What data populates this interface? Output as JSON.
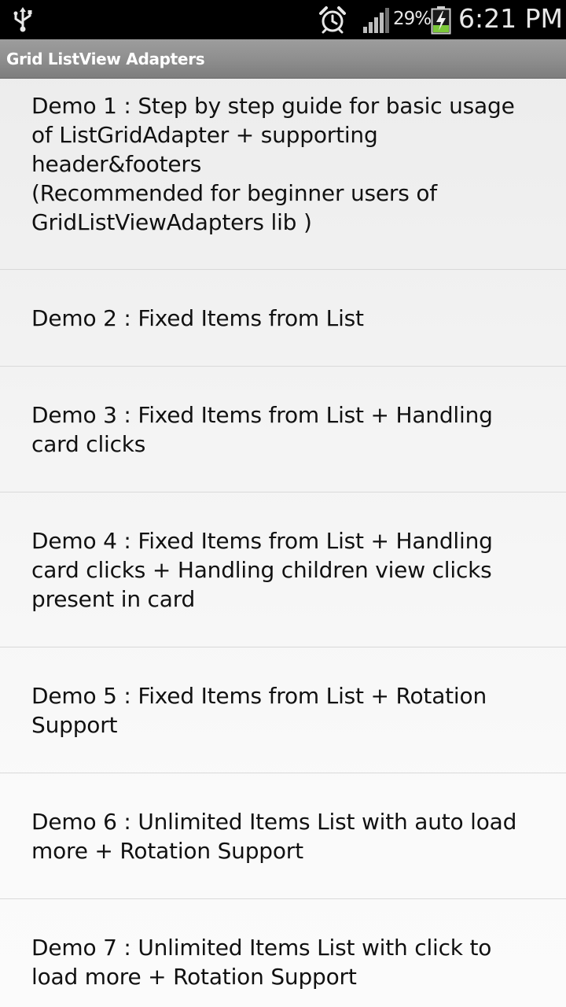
{
  "status_bar": {
    "battery_percent": "29%",
    "time": "6:21 PM",
    "icons": [
      "usb-icon",
      "alarm-icon",
      "signal-icon",
      "battery-charging-icon"
    ]
  },
  "title_bar": {
    "title": "Grid ListView Adapters"
  },
  "demos": [
    {
      "label": "Demo 1 : Step by step guide for basic usage of ListGridAdapter + supporting header&footers\n(Recommended for beginner users of GridListViewAdapters lib )"
    },
    {
      "label": "Demo 2 : Fixed Items from List"
    },
    {
      "label": "Demo 3 : Fixed Items from List + Handling card clicks"
    },
    {
      "label": "Demo 4 : Fixed Items from List + Handling card clicks + Handling children view clicks present in card"
    },
    {
      "label": "Demo 5 : Fixed Items from List + Rotation Support"
    },
    {
      "label": "Demo 6 : Unlimited Items List with auto load more + Rotation Support"
    },
    {
      "label": "Demo 7 : Unlimited Items List with click to load more + Rotation Support"
    }
  ],
  "colors": {
    "status_bar_bg": "#000000",
    "title_bar_bg": "#8f8f8f",
    "title_text": "#ffffff",
    "list_text": "#111111",
    "divider": "#d9d9d9",
    "battery_fill": "#7cc83a"
  }
}
